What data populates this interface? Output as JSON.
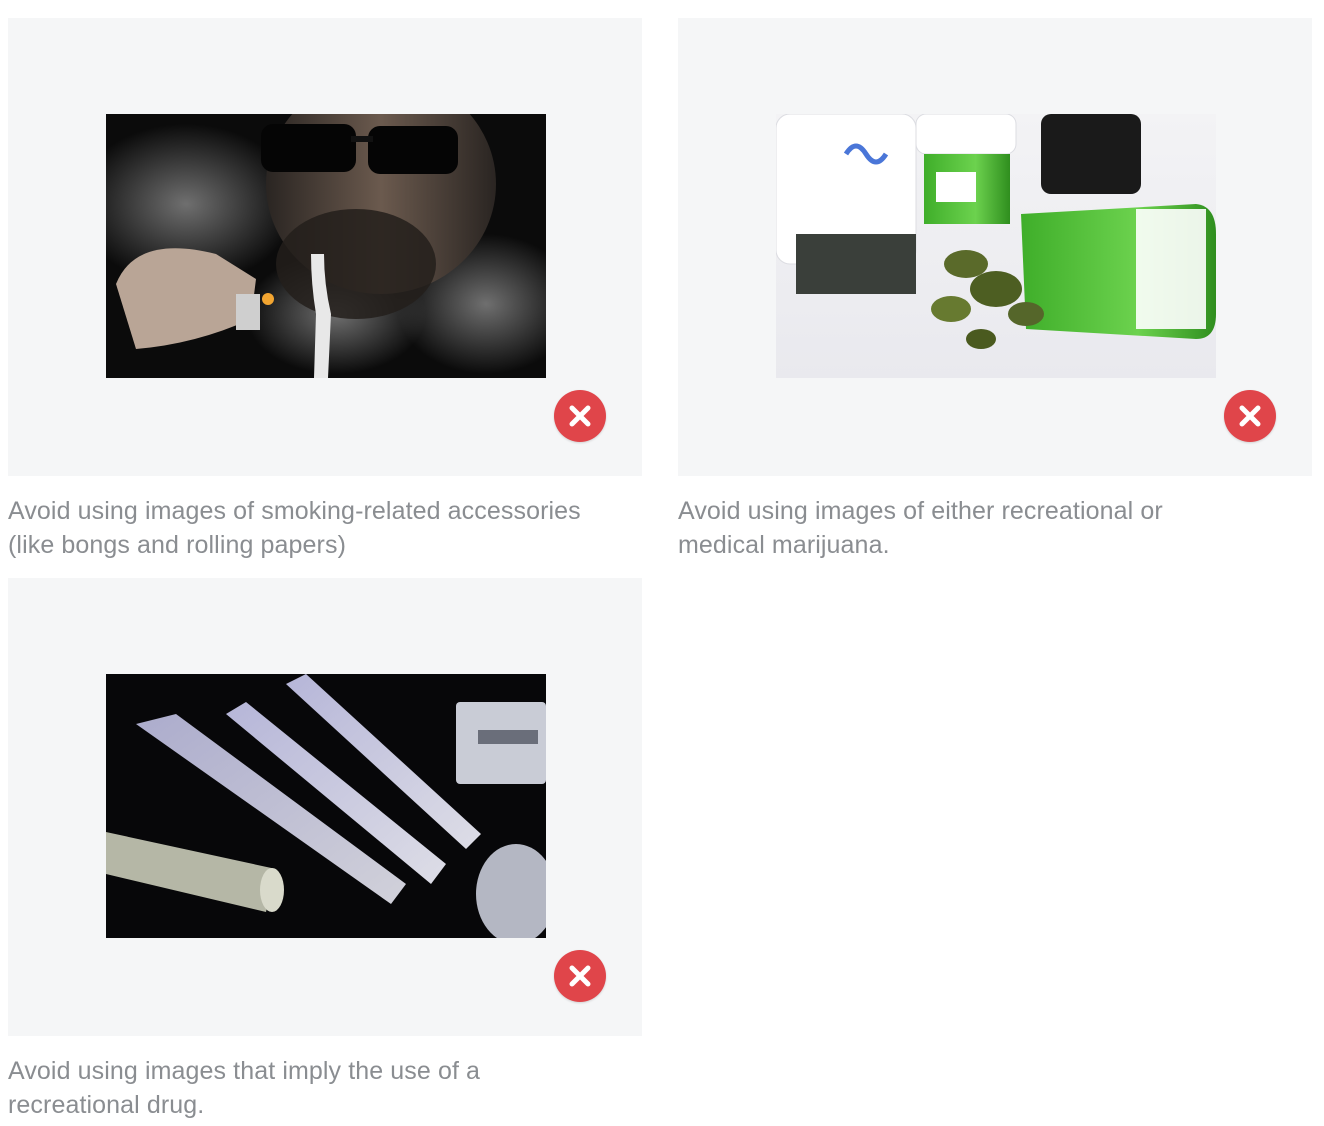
{
  "cards": [
    {
      "image_subject": "smoking-accessories-photo",
      "badge": "x-icon",
      "caption": "Avoid using images of smoking-related accessories\n(like bongs and rolling papers)"
    },
    {
      "image_subject": "marijuana-photo",
      "badge": "x-icon",
      "caption": "Avoid using images of either recreational or\nmedical marijuana."
    },
    {
      "image_subject": "drug-use-photo",
      "badge": "x-icon",
      "caption": "Avoid using images that imply the use of a\nrecreational drug."
    }
  ],
  "colors": {
    "panel_background": "#f5f6f7",
    "badge": "#e0454a",
    "caption_text": "#8a8d91"
  }
}
